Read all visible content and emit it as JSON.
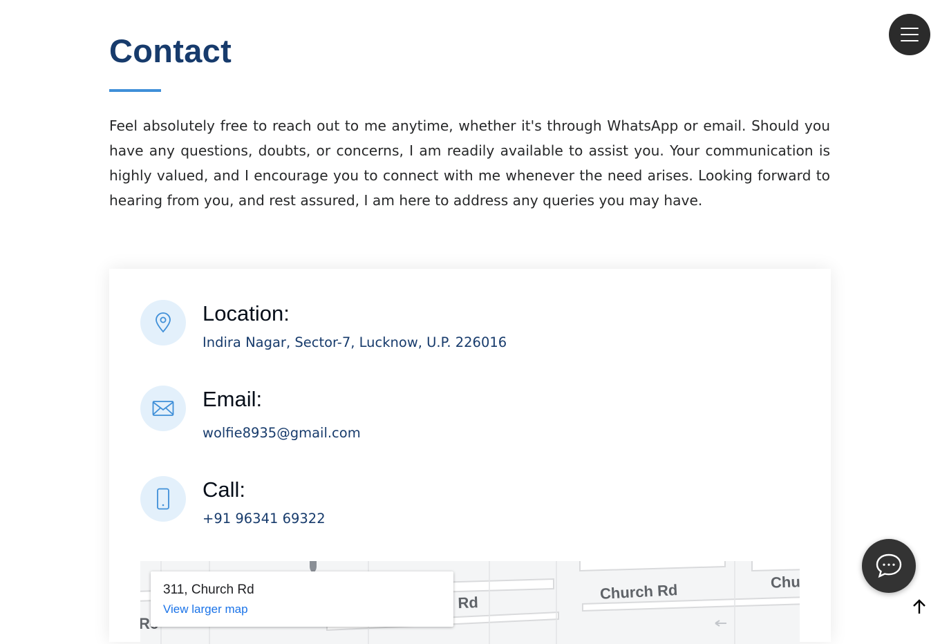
{
  "section": {
    "title": "Contact",
    "intro": "Feel absolutely free to reach out to me anytime, whether it's through WhatsApp or email. Should you have any questions, doubts, or concerns, I am readily available to assist you. Your communication is highly valued, and I encourage you to connect with me whenever the need arises. Looking forward to hearing from you, and rest assured, I am here to address any queries you may have."
  },
  "contact": {
    "location": {
      "heading": "Location:",
      "value": "Indira Nagar, Sector-7, Lucknow, U.P. 226016",
      "icon": "map-pin-icon"
    },
    "email": {
      "heading": "Email:",
      "value": "wolfie8935@gmail.com",
      "icon": "envelope-icon"
    },
    "call": {
      "heading": "Call:",
      "value": "+91 96341 69322",
      "icon": "phone-icon"
    }
  },
  "map": {
    "popup_title": "311, Church Rd",
    "popup_link": "View larger map",
    "street_labels": [
      "h Rd",
      "Church Rd",
      "Chu",
      "Rc"
    ]
  },
  "controls": {
    "menu_icon": "hamburger-menu-icon",
    "chat_icon": "chat-bubble-icon",
    "top_icon": "arrow-up-icon"
  },
  "colors": {
    "heading": "#173b6c",
    "accent": "#3f8fd8",
    "icon_bg": "#e3f0fb",
    "link": "#1a73e8",
    "floating_button": "#333333"
  }
}
